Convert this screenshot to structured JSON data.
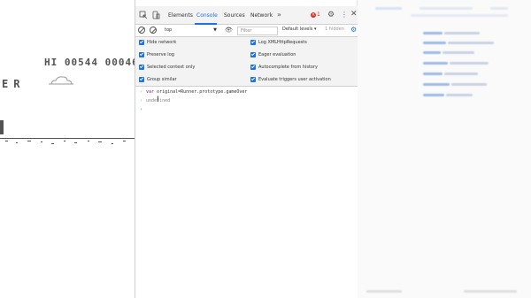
{
  "game": {
    "score_text": "HI 00544 00046",
    "game_over_fragment": "ER",
    "colors": {
      "ink": "#535353"
    }
  },
  "devtools": {
    "tabs": [
      {
        "label": "Elements",
        "active": false
      },
      {
        "label": "Console",
        "active": true
      },
      {
        "label": "Sources",
        "active": false
      },
      {
        "label": "Network",
        "active": false
      }
    ],
    "more_tabs_glyph": "»",
    "error_count": "1",
    "icons": {
      "inspect": "inspect-element-icon",
      "device": "device-toggle-icon",
      "settings": "gear-icon",
      "menu": "kebab-menu-icon",
      "close": "close-icon"
    },
    "toolbar": {
      "context_value": "top",
      "filter_placeholder": "Filter",
      "levels_label": "Default levels ▾",
      "hidden_count": "1 hidden"
    },
    "settings": {
      "left": [
        {
          "label": "Hide network",
          "checked": true
        },
        {
          "label": "Preserve log",
          "checked": true
        },
        {
          "label": "Selected context only",
          "checked": true
        },
        {
          "label": "Group similar",
          "checked": true
        }
      ],
      "right": [
        {
          "label": "Log XMLHttpRequests",
          "checked": true
        },
        {
          "label": "Eager evaluation",
          "checked": true
        },
        {
          "label": "Autocomplete from history",
          "checked": true
        },
        {
          "label": "Evaluate triggers user activation",
          "checked": true
        }
      ]
    },
    "console": {
      "input_keyword": "var",
      "input_rest": " original=Runner.prototype.gameOver",
      "result": "undefined",
      "prompt_glyph": "›"
    },
    "accent": "#1a73e8",
    "error_color": "#d93025"
  }
}
